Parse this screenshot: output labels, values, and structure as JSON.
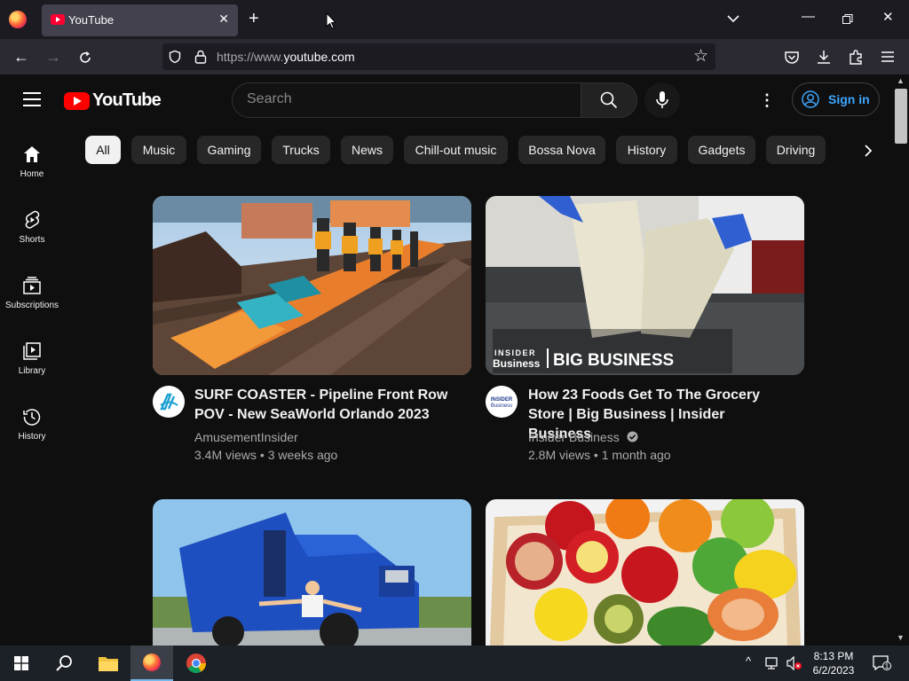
{
  "browser": {
    "tab_title": "YouTube",
    "url_scheme": "https://www.",
    "url_host": "youtube.com"
  },
  "header": {
    "logo_text": "YouTube",
    "search_placeholder": "Search",
    "signin_label": "Sign in"
  },
  "sidebar": {
    "items": [
      {
        "label": "Home",
        "icon": "home-icon"
      },
      {
        "label": "Shorts",
        "icon": "shorts-icon"
      },
      {
        "label": "Subscriptions",
        "icon": "subscriptions-icon"
      },
      {
        "label": "Library",
        "icon": "library-icon"
      },
      {
        "label": "History",
        "icon": "history-icon"
      }
    ]
  },
  "chips": [
    "All",
    "Music",
    "Gaming",
    "Trucks",
    "News",
    "Chill-out music",
    "Bossa Nova",
    "History",
    "Gadgets",
    "Driving"
  ],
  "videos": [
    {
      "title": "SURF COASTER - Pipeline Front Row POV - New SeaWorld Orlando 2023",
      "channel": "AmusementInsider",
      "verified": false,
      "views": "3.4M views",
      "age": "3 weeks ago",
      "thumb_caption": ""
    },
    {
      "title": "How 23 Foods Get To The Grocery Store | Big Business | Insider Business",
      "channel": "Insider Business",
      "verified": true,
      "views": "2.8M views",
      "age": "1 month ago",
      "thumb_caption_top": "INSIDER",
      "thumb_caption_sub": "Business",
      "thumb_caption_main": "BIG BUSINESS",
      "avatar_top": "INSIDER",
      "avatar_sub": "Business"
    }
  ],
  "taskbar": {
    "time": "8:13 PM",
    "date": "6/2/2023",
    "notification_count": "1"
  },
  "colors": {
    "brand_red": "#ff0000",
    "link_blue": "#3ea6ff",
    "background": "#0f0f0f"
  }
}
